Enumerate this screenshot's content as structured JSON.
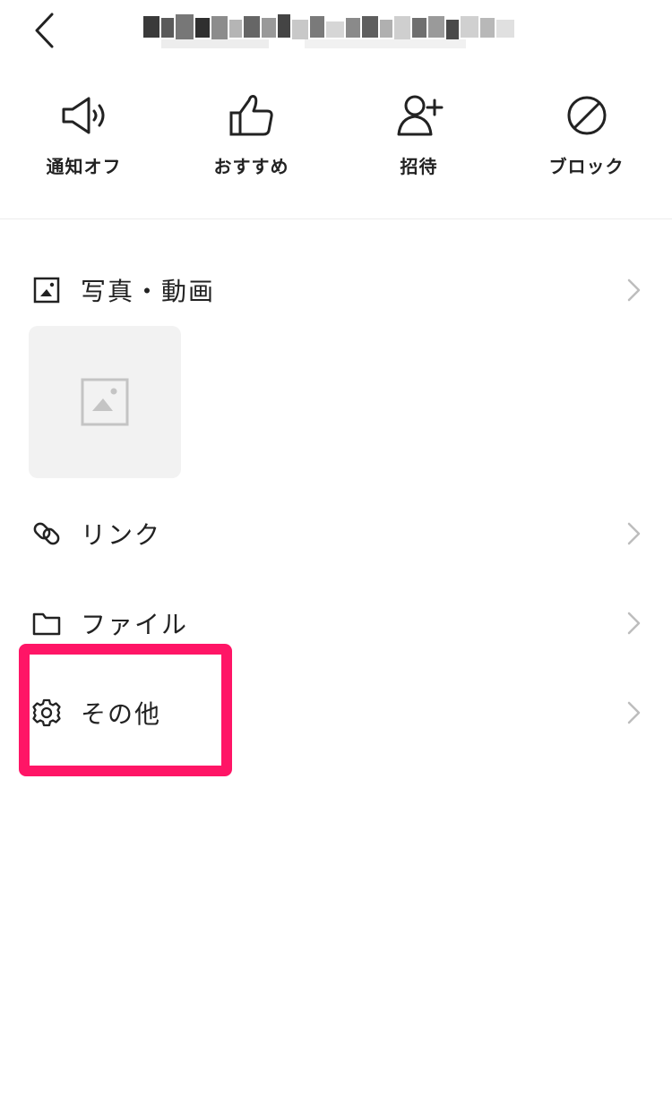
{
  "header": {
    "back_icon": "chevron-left-icon",
    "title": ""
  },
  "actions": [
    {
      "label": "通知オフ",
      "icon": "speaker-icon"
    },
    {
      "label": "おすすめ",
      "icon": "thumbs-up-icon"
    },
    {
      "label": "招待",
      "icon": "add-user-icon"
    },
    {
      "label": "ブロック",
      "icon": "block-icon"
    }
  ],
  "menu": {
    "photos": {
      "label": "写真・動画",
      "icon": "image-icon"
    },
    "links": {
      "label": "リンク",
      "icon": "link-icon"
    },
    "files": {
      "label": "ファイル",
      "icon": "folder-icon"
    },
    "other": {
      "label": "その他",
      "icon": "gear-icon"
    }
  },
  "colors": {
    "highlight": "#ff1566",
    "text": "#1e1e1e",
    "chevron": "#bdbdbd"
  }
}
